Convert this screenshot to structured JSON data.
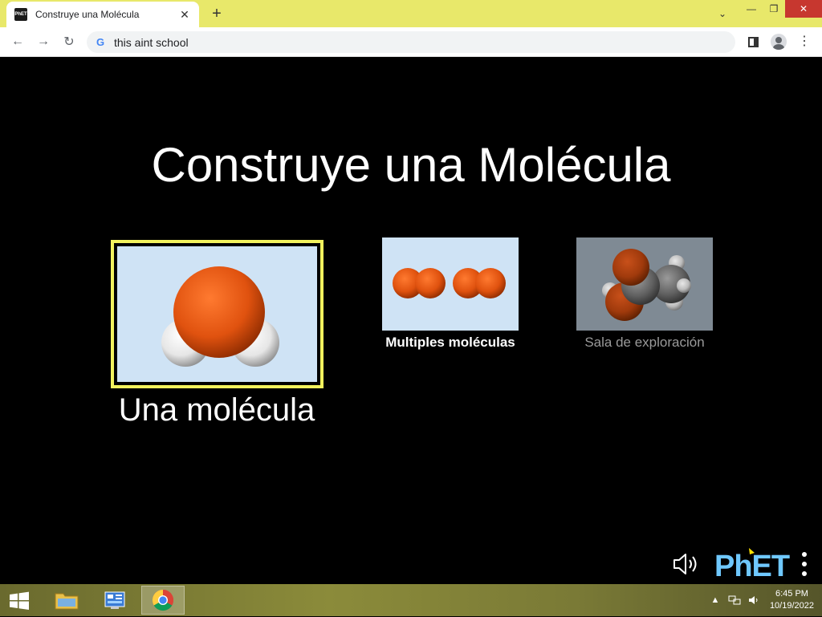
{
  "browser": {
    "tab_title": "Construye una Molécula",
    "favicon_text": "PhET",
    "address": "this aint school"
  },
  "sim": {
    "title": "Construye una Molécula",
    "screens": [
      {
        "label": "Una molécula",
        "selected": true
      },
      {
        "label": "Multiples moléculas",
        "selected": false
      },
      {
        "label": "Sala de exploración",
        "selected": false
      }
    ],
    "logo_text": "PhET"
  },
  "taskbar": {
    "time": "6:45 PM",
    "date": "10/19/2022"
  },
  "colors": {
    "tabstrip": "#e8e86a",
    "selection_frame": "#f2f25e",
    "oxygen": "#e0520f",
    "hydrogen": "#ffffff",
    "carbon": "#606060",
    "thumb_bg": "#cfe3f5",
    "logo_blue": "#6fc8ff",
    "logo_yellow": "#ffe200"
  }
}
